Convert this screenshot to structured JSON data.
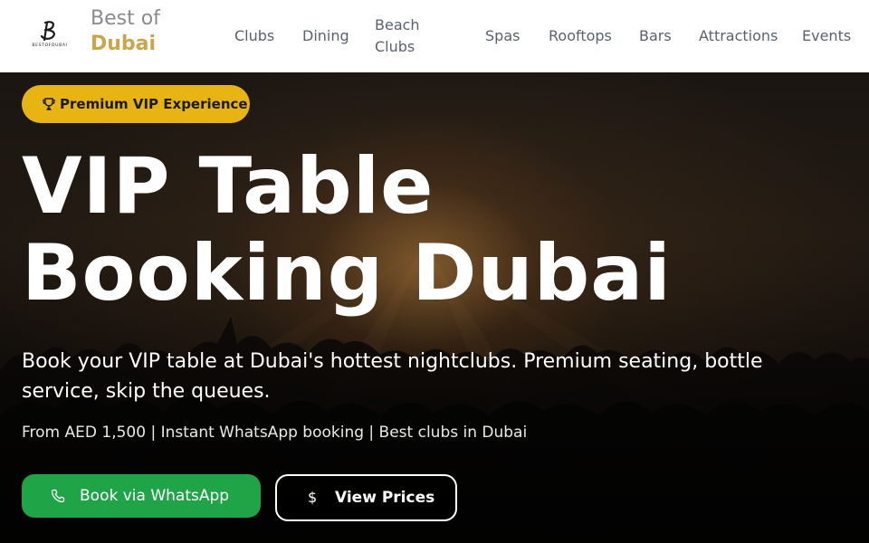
{
  "header": {
    "logo_small_text": "BESTOFDUBAI",
    "brand_line1": "Best of",
    "brand_line2": "Dubai",
    "nav": [
      {
        "label": "Clubs"
      },
      {
        "label": "Dining"
      },
      {
        "label": "Beach Clubs"
      },
      {
        "label": "Spas"
      },
      {
        "label": "Rooftops"
      },
      {
        "label": "Bars"
      },
      {
        "label": "Attractions"
      },
      {
        "label": "Events"
      }
    ]
  },
  "hero": {
    "badge": {
      "icon": "trophy-icon",
      "label": "Premium VIP Experience"
    },
    "title_line1": "VIP Table",
    "title_line2": "Booking Dubai",
    "subtitle": "Book your VIP table at Dubai's hottest nightclubs. Premium seating, bottle service, skip the queues.",
    "meta": "From AED 1,500 | Instant WhatsApp booking | Best clubs in Dubai",
    "primary_button": {
      "icon": "phone-icon",
      "label": "Book via WhatsApp"
    },
    "secondary_button": {
      "icon": "dollar-icon",
      "label": "View Prices",
      "icon_glyph": "$"
    }
  },
  "colors": {
    "header_bg": "#ffffff",
    "brand_gold": "#c9a64a",
    "badge_yellow": "#e8b413",
    "whatsapp_green": "#1fa447",
    "nav_text": "#5a6270"
  }
}
